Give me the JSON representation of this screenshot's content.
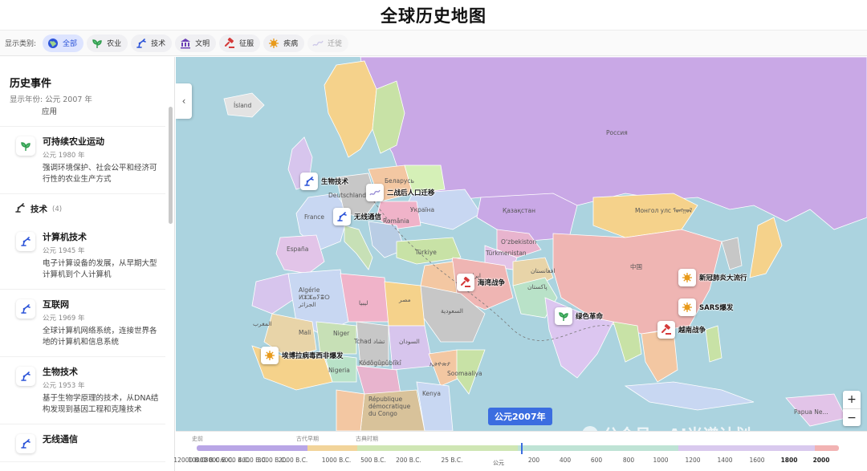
{
  "app": {
    "title": "全球历史地图"
  },
  "filters": {
    "label": "显示类别:",
    "items": [
      {
        "id": "all",
        "label": "全部",
        "icon": "globe-icon",
        "active": true
      },
      {
        "id": "agri",
        "label": "农业",
        "icon": "sprout-icon",
        "active": false
      },
      {
        "id": "tech",
        "label": "技术",
        "icon": "robot-arm-icon",
        "active": false
      },
      {
        "id": "civ",
        "label": "文明",
        "icon": "temple-icon",
        "active": false
      },
      {
        "id": "conquest",
        "label": "征服",
        "icon": "gavel-icon",
        "active": false
      },
      {
        "id": "disease",
        "label": "疾病",
        "icon": "virus-icon",
        "active": false
      },
      {
        "id": "migration",
        "label": "迁徙",
        "icon": "wave-icon",
        "active": false
      }
    ]
  },
  "sidebar": {
    "title": "历史事件",
    "subtitle": "显示年份: 公元 2007 年",
    "cut_text": "应用",
    "agri_events": [
      {
        "title": "可持续农业运动",
        "year": "公元 1980 年",
        "desc": "强调环境保护、社会公平和经济可行性的农业生产方式"
      }
    ],
    "tech_group": {
      "label": "技术",
      "count": "(4)"
    },
    "tech_events": [
      {
        "title": "计算机技术",
        "year": "公元 1945 年",
        "desc": "电子计算设备的发展，从早期大型计算机到个人计算机"
      },
      {
        "title": "互联网",
        "year": "公元 1969 年",
        "desc": "全球计算机网络系统，连接世界各地的计算机和信息系统"
      },
      {
        "title": "生物技术",
        "year": "公元 1953 年",
        "desc": "基于生物学原理的技术，从DNA结构发现到基因工程和克隆技术"
      },
      {
        "title": "无线通信",
        "year": "",
        "desc": ""
      }
    ]
  },
  "map": {
    "country_labels": {
      "iceland": "Ísland",
      "russia": "Россия",
      "kazakhstan": "Қазақстан",
      "mongolia": "Монгол\nулс ᠮᠣᠩᠭᠣᠯ",
      "china": "中国",
      "uzbekistan": "Oʻzbekiston",
      "turkmenistan": "Türkmenistan",
      "turkiye": "Türkiye",
      "ukraine": "Україна",
      "belarus": "Беларусь",
      "germany": "Deutschland",
      "france": "France",
      "espana": "España",
      "algeria": "Algérie\nⵍⵣⵣⴰⵢⴻⵔ\nالجزائر",
      "libya": "ليبيا",
      "egypt": "مصر",
      "saudi": "السعودية",
      "mali": "Mali",
      "niger": "Niger",
      "chad": "Tchad تشاد",
      "sudan": "السودان",
      "ethiopia": "ኢትዮጵያ",
      "somalia": "Soomaaliya",
      "nigeria": "Nigeria",
      "kenya": "Kenya",
      "drc": "République\ndémocratique\ndu Congo",
      "romania": "România",
      "pakistan": "پاکستان",
      "afghanistan": "افغانستان",
      "iran": "ایران",
      "papua": "Papua Ne...",
      "morocco": "المغرب",
      "kodougou": "Kódôgûpûblîkî"
    },
    "markers": [
      {
        "id": "biotech",
        "label": "生物技术",
        "icon": "robot-arm-icon"
      },
      {
        "id": "migration",
        "label": "二战后人口迁移",
        "icon": "wave-icon"
      },
      {
        "id": "wireless",
        "label": "无线通信",
        "icon": "robot-arm-icon"
      },
      {
        "id": "gulf-war",
        "label": "海湾战争",
        "icon": "gavel-icon"
      },
      {
        "id": "covid",
        "label": "新冠肺炎大流行",
        "icon": "virus-icon"
      },
      {
        "id": "sars",
        "label": "SARS爆发",
        "icon": "virus-icon"
      },
      {
        "id": "green-rev",
        "label": "绿色革命",
        "icon": "sprout-icon"
      },
      {
        "id": "vietnam",
        "label": "越南战争",
        "icon": "gavel-icon"
      },
      {
        "id": "ebola",
        "label": "埃博拉病毒西非爆发",
        "icon": "virus-icon"
      }
    ],
    "year_badge": "公元2007年",
    "zoom_in": "+",
    "zoom_out": "−",
    "watermark": "公众号 · AI光谱计划"
  },
  "timeline": {
    "eras": [
      "史前",
      "古代早期",
      "古典时期"
    ],
    "ticks": [
      "12000 B.C.",
      "10000 B.C.",
      "8000 B.C.",
      "6000 B.C.",
      "4000 B.C.",
      "3000 B.C.",
      "2000 B.C.",
      "1000 B.C.",
      "500 B.C.",
      "200 B.C.",
      "25 B.C.",
      "公元",
      "200",
      "400",
      "600",
      "800",
      "1000",
      "1200",
      "1400",
      "1600",
      "1800",
      "2000"
    ],
    "current_year": 2007
  },
  "colors": {
    "accent": "#3b6de0",
    "sea": "#abd3df",
    "russia": "#c9a8e6",
    "china": "#efb5b3"
  }
}
